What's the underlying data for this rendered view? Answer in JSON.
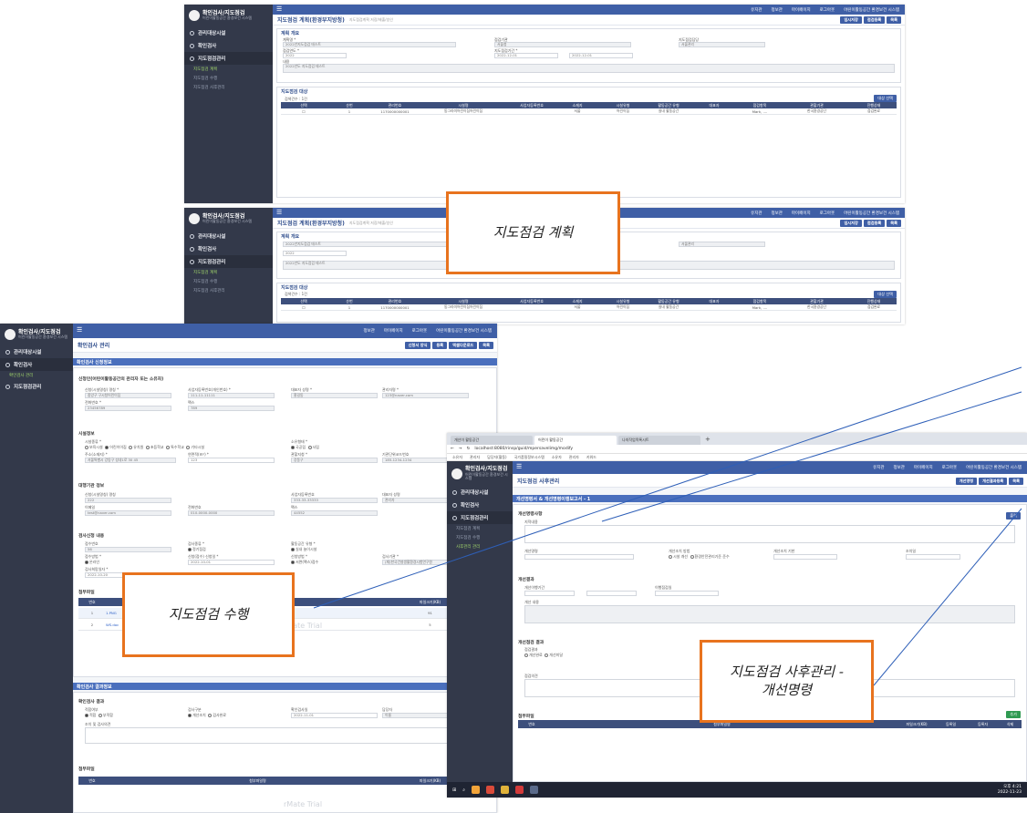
{
  "app": {
    "logo_title": "확인검사/지도점검",
    "logo_subtitle": "어린이활동공간 환경보건 시스템",
    "topbar_user": "정보관",
    "topbar_items": [
      "유지관",
      "마이페이지",
      "로그아웃",
      "어린이활동공간 환경보건 시스템"
    ]
  },
  "plan_screen": {
    "breadcrumb": "지도점검 계획(환경부지방청)",
    "breadcrumb_note": "지도점검계획 저장/제출/승인",
    "buttons": [
      "임시저장",
      "점검등록",
      "목록"
    ],
    "nav": {
      "items": [
        "관리대상시설",
        "확인검사",
        "지도점검관리"
      ],
      "subs": [
        "지도점검 계획",
        "지도점검 수행",
        "지도점검 사후관리"
      ]
    },
    "plan_section_title": "계획 개요",
    "fields": [
      {
        "label": "계획명 *",
        "value": "2022년지도점검 테스트"
      },
      {
        "label": "점검기관",
        "value": "서울청"
      },
      {
        "label": "지도점검담당",
        "value": "서울관리"
      },
      {
        "label": "점검연도 *",
        "value": "2022"
      },
      {
        "label": "지도점검기간 *",
        "value": "2022-12-01"
      },
      {
        "label": "",
        "value": "2022-12-01"
      },
      {
        "label": "내용",
        "value": "2022년도 지도점검 테스트"
      }
    ],
    "target_section_title": "지도점검 대상",
    "target_count": "검색건수 : 1건",
    "target_button": "대상 선택",
    "table_headers": [
      "선택",
      "순번",
      "관리번호",
      "시설명",
      "사업자등록번호",
      "소재지",
      "시설유형",
      "활동공간 유형",
      "대표자",
      "점검항목",
      "관할기관",
      "진행상태"
    ],
    "table_row": [
      "",
      "1",
      "1170000000001",
      "동그라미어린이집어린이집",
      "",
      "서울",
      "어린이집",
      "실내 활동공간",
      "",
      "Mark, ....",
      "한국환경공단",
      "점검완료"
    ]
  },
  "inspection_screen": {
    "breadcrumb": "확인검사 관리",
    "buttons": [
      "신청서 양식",
      "등록",
      "엑셀다운로드",
      "목록"
    ],
    "nav": {
      "items": [
        "관리대상시설",
        "확인검사",
        "지도점검관리"
      ],
      "subs": [
        "확인검사 관리"
      ]
    },
    "bar_title": "확인검사 신청정보",
    "applicant_title": "신청인(어린이활동공간의 관리자 또는 소유자)",
    "applicant_fields": [
      {
        "label": "신청(시설명칭) 명칭 *",
        "value": "중앙구 구시청어린이집"
      },
      {
        "label": "사업자등록번호(개인번호) *",
        "value": "111-11-11111"
      },
      {
        "label": "대표자 성명 *",
        "value": "홍길동"
      },
      {
        "label": "관리자명 *",
        "value": "123@naver.com"
      },
      {
        "label": "전화번호 *",
        "value": "23456789"
      },
      {
        "label": "팩스",
        "value": "789"
      }
    ],
    "facility_title": "시설정보",
    "facility_radios": [
      "보육시설",
      "어린이이집",
      "유치원",
      "초등학교",
      "특수학교",
      "기타시설"
    ],
    "ownership_label": "소유형태 *",
    "ownership_radios": [
      "국공립",
      "사립"
    ],
    "address_label": "주소(소재지) *",
    "address_value": "서울특별시 강동구 성내1로 30 45",
    "area_label": "연면적(m²) *",
    "area_value": "123",
    "capacity_label": "관할지청 *",
    "capacity_value": "강동구",
    "biz_label": "기관단위코드번호",
    "biz_value": "185-1234-1234",
    "agency_title": "대행기관 정보",
    "agency_fields": [
      {
        "label": "신청(시설명칭) 명칭",
        "value": "222"
      },
      {
        "label": "사업자등록번호",
        "value": "333-33-33333"
      },
      {
        "label": "대표자 성명",
        "value": "관리자"
      },
      {
        "label": "이메일",
        "value": "test@naver.com"
      },
      {
        "label": "전화번호",
        "value": "010-0000-0000"
      },
      {
        "label": "팩스",
        "value": "44552"
      }
    ],
    "apply_title": "검사신청 내용",
    "apply_fields": [
      {
        "label": "접수번호",
        "value": "56"
      },
      {
        "label": "검사종류 *",
        "value": "정기점검"
      },
      {
        "label": "활동공간 유형 *",
        "value": "실내 놀이시설"
      },
      {
        "label": "접수방법 *",
        "value": "온라인"
      },
      {
        "label": "신청(접수) 신청일 *",
        "value": "2022-10-01"
      },
      {
        "label": "신청방법 *",
        "value": "서면(팩스)접수"
      },
      {
        "label": "검사기관 *",
        "value": "(재)한국건설생활환경시험연구원"
      },
      {
        "label": "검사희망일자 *",
        "value": "2022-10-20"
      }
    ],
    "file_title": "첨부파일",
    "file_headers": [
      "번호",
      "첨부파일명",
      "파일크기(KB)",
      "등록일"
    ],
    "file_rows": [
      {
        "no": "1",
        "name": "1.PNG",
        "size": "91",
        "date": "2022-10-20"
      },
      {
        "no": "2",
        "name": "WS.doc",
        "size": "5",
        "date": "2022-10-20"
      }
    ],
    "result_bar_title": "확인검사 결과정보",
    "result_title": "확인검사 결과",
    "result_fields": [
      {
        "label": "적합여부",
        "value": "적합"
      },
      {
        "label": "검사구분",
        "value": "개선조치"
      },
      {
        "label": "확인검사일",
        "value": "2022-11-01"
      },
      {
        "label": "담당자",
        "value": "이름"
      }
    ],
    "result_radio_a": [
      "적합",
      "부적합"
    ],
    "result_radio_b": [
      "개선조치",
      "검사완료"
    ],
    "opinion_label": "조치 및 검사의견",
    "file2_title": "첨부파일",
    "file2_headers": [
      "번호",
      "첨부파일명",
      "파일크기(KB)",
      "등록일"
    ],
    "watermark": "rMate Trial"
  },
  "followup_screen": {
    "browser_tabs": [
      "개선이 활동공간",
      "어린이 활동공간",
      "나의작업목록시트"
    ],
    "url": "localhost:8080/rinsp/guid/mpersavelimg/modify",
    "bookmarks": [
      "소유자",
      "관리자",
      "담당자(활동)",
      "국가품질정보시스템",
      "소유자",
      "관리자",
      "키워드"
    ],
    "breadcrumb": "지도점검 사후관리",
    "buttons": [
      "개선명령",
      "개선결과등록",
      "목록"
    ],
    "nav": {
      "items": [
        "관리대상시설",
        "확인검사",
        "지도점검관리"
      ],
      "subs": [
        "지도점검 계획",
        "지도점검 수행",
        "사후관리 관리"
      ]
    },
    "bar_title": "개선명령서 & 개선명령이행보고서 - 1",
    "order_title": "개선명령사항",
    "order_button": "출력",
    "order_content_label": "지적내용",
    "order_fields": [
      {
        "label": "개선명령",
        "value": ""
      },
      {
        "label": "개선조치 방법",
        "value": ""
      },
      {
        "label": "개선조치 기한",
        "value": ""
      },
      {
        "label": "조치일",
        "value": ""
      }
    ],
    "order_radios": [
      "시설 개선",
      "환경안전관리기준 준수"
    ],
    "result_title": "개선결과",
    "result_fields": [
      {
        "label": "개선이행기간",
        "value": ""
      },
      {
        "label": "이행점검일",
        "value": ""
      },
      {
        "label": "개선 내용",
        "value": ""
      }
    ],
    "check_title": "개선점검 결과",
    "check_label": "점검결과",
    "check_radios": [
      "개선완료",
      "개선미달"
    ],
    "check_opinion": "점검의견",
    "file_title": "첨부파일",
    "file_button": "추가",
    "file_headers": [
      "번호",
      "첨부파일명",
      "파일크기(KB)",
      "등록일",
      "등록자",
      "삭제"
    ],
    "clock_time": "오후 4:21",
    "clock_date": "2022-11-23"
  },
  "callouts": {
    "plan": "지도점검 계획",
    "perform": "지도점검 수행",
    "followup": "지도점검 사후관리 -\n개선명령"
  },
  "colors": {
    "accent_orange": "#e8731e",
    "nav_dark": "#33394a",
    "topbar_blue": "#3f5fa6",
    "connector_blue": "#2e5fb8"
  }
}
